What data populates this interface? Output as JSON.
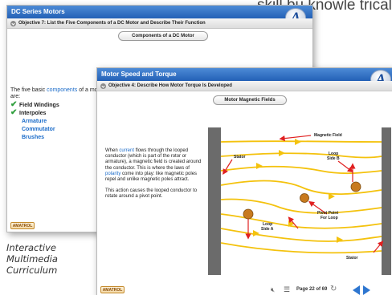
{
  "background_text": "skill bu knowle trical r",
  "back_window": {
    "title": "DC Series Motors",
    "objective": "Objective 7: List the Five Components of a DC Motor and Describe Their Function",
    "pill": "Components of a DC Motor",
    "intro_prefix": "The five basic ",
    "intro_link": "components",
    "intro_suffix": " of a motor are:",
    "components": [
      {
        "label": "Field Windings",
        "checked": true
      },
      {
        "label": "Interpoles",
        "checked": true
      },
      {
        "label": "Armature",
        "checked": false
      },
      {
        "label": "Commutator",
        "checked": false
      },
      {
        "label": "Brushes",
        "checked": false
      }
    ],
    "brand": "AMATROL"
  },
  "front_window": {
    "title": "Motor Speed and Torque",
    "objective": "Objective 4: Describe How Motor Torque Is Developed",
    "pill": "Motor Magnetic Fields",
    "para1_a": "When ",
    "para1_link1": "current",
    "para1_b": " flows through the looped conductor (which is part of the rotor or armature), a magnetic field is created around the conductor. This is where the laws of ",
    "para1_link2": "polarity",
    "para1_c": " come into play: like magnetic poles repel and unlike magnetic poles attract.",
    "para2": "This action causes the looped conductor to rotate around a pivot point.",
    "diagram_labels": {
      "magnetic_field": "Magnetic Field",
      "stator_left": "Stator",
      "stator_right": "Stator",
      "loop_side_b_1": "Loop",
      "loop_side_b_2": "Side B",
      "pivot_1": "Pivot Point",
      "pivot_2": "For Loop",
      "loop_side_a_1": "Loop",
      "loop_side_a_2": "Side A"
    },
    "page_label": "Page 22 of 69",
    "brand": "AMATROL"
  },
  "caption": {
    "line1": "Interactive",
    "line2": "Multimedia",
    "line3": "Curriculum"
  },
  "colors": {
    "titlebar": "#2e6fc7",
    "link": "#1a6bc9",
    "check": "#2e9e3c",
    "field_lines": "#f4c20d",
    "arrows": "#e02020",
    "stator": "#6b6b6b",
    "conductor": "#c87a1e"
  },
  "icons": [
    "logo-a-icon",
    "chevron-down-icon",
    "check-icon",
    "speaker-mute-icon",
    "menu-icon",
    "refresh-icon",
    "prev-arrow-icon",
    "next-arrow-icon"
  ]
}
